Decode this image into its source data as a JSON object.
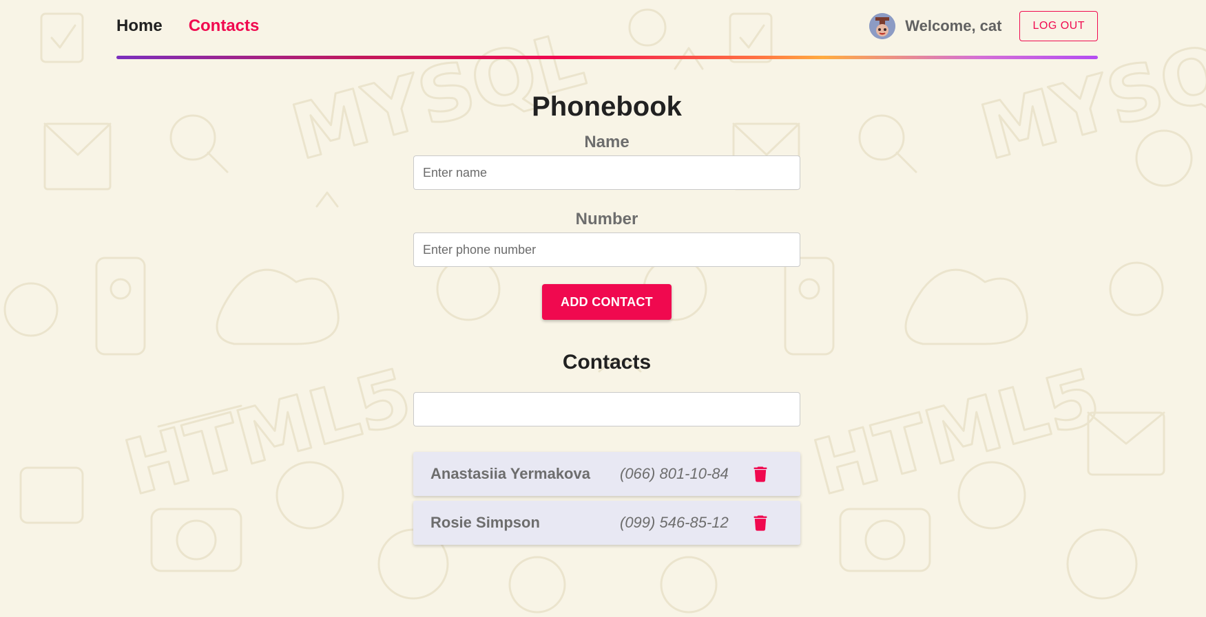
{
  "header": {
    "nav": {
      "home": "Home",
      "contacts": "Contacts"
    },
    "welcome": "Welcome, cat",
    "logout": "LOG OUT"
  },
  "phonebook": {
    "title": "Phonebook",
    "name_label": "Name",
    "name_placeholder": "Enter name",
    "number_label": "Number",
    "number_placeholder": "Enter phone number",
    "add_button": "ADD CONTACT"
  },
  "contacts_section": {
    "title": "Contacts",
    "filter_value": "",
    "items": [
      {
        "name": "Anastasiia Yermakova",
        "number": "(066) 801-10-84"
      },
      {
        "name": "Rosie Simpson",
        "number": "(099) 546-85-12"
      }
    ]
  },
  "icons": {
    "delete": "trash-icon",
    "avatar": "avatar"
  },
  "colors": {
    "accent": "#f0094f",
    "background": "#f8f4e6",
    "contact_card": "#e8e8f3"
  }
}
